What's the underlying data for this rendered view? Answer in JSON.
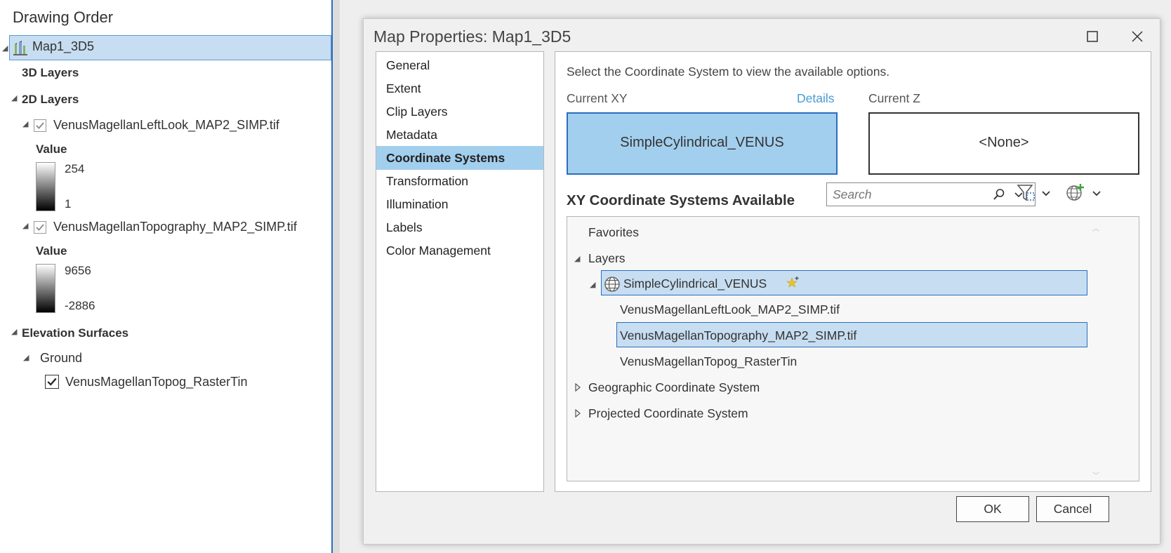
{
  "drawing_order": {
    "title": "Drawing Order",
    "map_name": "Map1_3D5",
    "groups": {
      "layers_3d": "3D Layers",
      "layers_2d": "2D Layers",
      "elevation": "Elevation Surfaces"
    },
    "layer1": {
      "name": "VenusMagellanLeftLook_MAP2_SIMP.tif",
      "value_label": "Value",
      "high": "254",
      "low": "1",
      "checked": true
    },
    "layer2": {
      "name": "VenusMagellanTopography_MAP2_SIMP.tif",
      "value_label": "Value",
      "high": "9656",
      "low": "-2886",
      "checked": true
    },
    "ground": {
      "label": "Ground",
      "surface": "VenusMagellanTopog_RasterTin",
      "checked": true
    }
  },
  "dialog": {
    "title": "Map Properties: Map1_3D5",
    "nav_items": [
      "General",
      "Extent",
      "Clip Layers",
      "Metadata",
      "Coordinate Systems",
      "Transformation",
      "Illumination",
      "Labels",
      "Color Management"
    ],
    "active_nav": "Coordinate Systems",
    "instruction": "Select the Coordinate System to view the available options.",
    "current_xy_label": "Current XY",
    "details_link": "Details",
    "current_xy_value": "SimpleCylindrical_VENUS",
    "current_z_label": "Current Z",
    "current_z_value": "<None>",
    "available_title": "XY Coordinate Systems Available",
    "search_placeholder": "Search",
    "tree": {
      "favorites": "Favorites",
      "layers": "Layers",
      "cs_name": "SimpleCylindrical_VENUS",
      "layer_items": [
        "VenusMagellanLeftLook_MAP2_SIMP.tif",
        "VenusMagellanTopography_MAP2_SIMP.tif",
        "VenusMagellanTopog_RasterTin"
      ],
      "geographic": "Geographic Coordinate System",
      "projected": "Projected Coordinate System"
    },
    "ok_label": "OK",
    "cancel_label": "Cancel"
  },
  "colors": {
    "accent": "#2a6ebb",
    "selection": "#c7ddf1",
    "active_nav": "#a3cfee",
    "link": "#4a9bd3"
  }
}
